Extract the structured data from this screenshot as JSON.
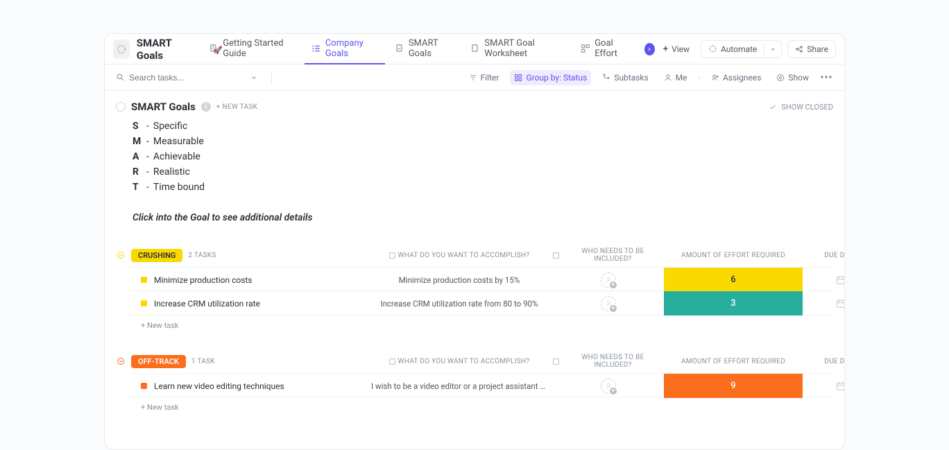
{
  "header": {
    "title": "SMART Goals",
    "tabs": [
      {
        "label": "Getting Started Guide"
      },
      {
        "label": "Company Goals"
      },
      {
        "label": "SMART Goals"
      },
      {
        "label": "SMART Goal Worksheet"
      },
      {
        "label": "Goal Effort"
      }
    ],
    "add_view": "View",
    "automate": "Automate",
    "share": "Share"
  },
  "toolbar": {
    "search_placeholder": "Search tasks...",
    "filter": "Filter",
    "group_by": "Group by: Status",
    "subtasks": "Subtasks",
    "me": "Me",
    "assignees": "Assignees",
    "show": "Show"
  },
  "list": {
    "title": "SMART Goals",
    "new_task": "+ NEW TASK",
    "show_closed": "SHOW CLOSED",
    "smart": [
      {
        "letter": "S",
        "word": "Specific"
      },
      {
        "letter": "M",
        "word": "Measurable"
      },
      {
        "letter": "A",
        "word": "Achievable"
      },
      {
        "letter": "R",
        "word": "Realistic"
      },
      {
        "letter": "T",
        "word": "Time bound"
      }
    ],
    "hint": "Click into the Goal to see additional details"
  },
  "columns": {
    "accomplish": "WHAT DO YOU WANT TO ACCOMPLISH?",
    "included": "WHO NEEDS TO BE INCLUDED?",
    "effort": "AMOUNT OF EFFORT REQUIRED",
    "due": "DUE DATE"
  },
  "groups": [
    {
      "name": "CRUSHING",
      "color": "#f9d900",
      "text_color": "#2a2e34",
      "count_label": "2 TASKS",
      "tasks": [
        {
          "name": "Minimize production costs",
          "accomplish": "Minimize production costs by 15%",
          "effort": "6",
          "effort_color": "#f9d900",
          "effort_text": "#2a2e34"
        },
        {
          "name": "Increase CRM utilization rate",
          "accomplish": "Increase CRM utilization rate from 80 to 90%",
          "effort": "3",
          "effort_color": "#27ae9c",
          "effort_text": "#fff"
        }
      ]
    },
    {
      "name": "OFF-TRACK",
      "color": "#fa6e1e",
      "text_color": "#ffffff",
      "count_label": "1 TASK",
      "tasks": [
        {
          "name": "Learn new video editing techniques",
          "accomplish": "I wish to be a video editor or a project assistant mainly ...",
          "effort": "9",
          "effort_color": "#fa6e1e",
          "effort_text": "#fff"
        }
      ]
    }
  ],
  "labels": {
    "new_task_link": "+ New task"
  }
}
